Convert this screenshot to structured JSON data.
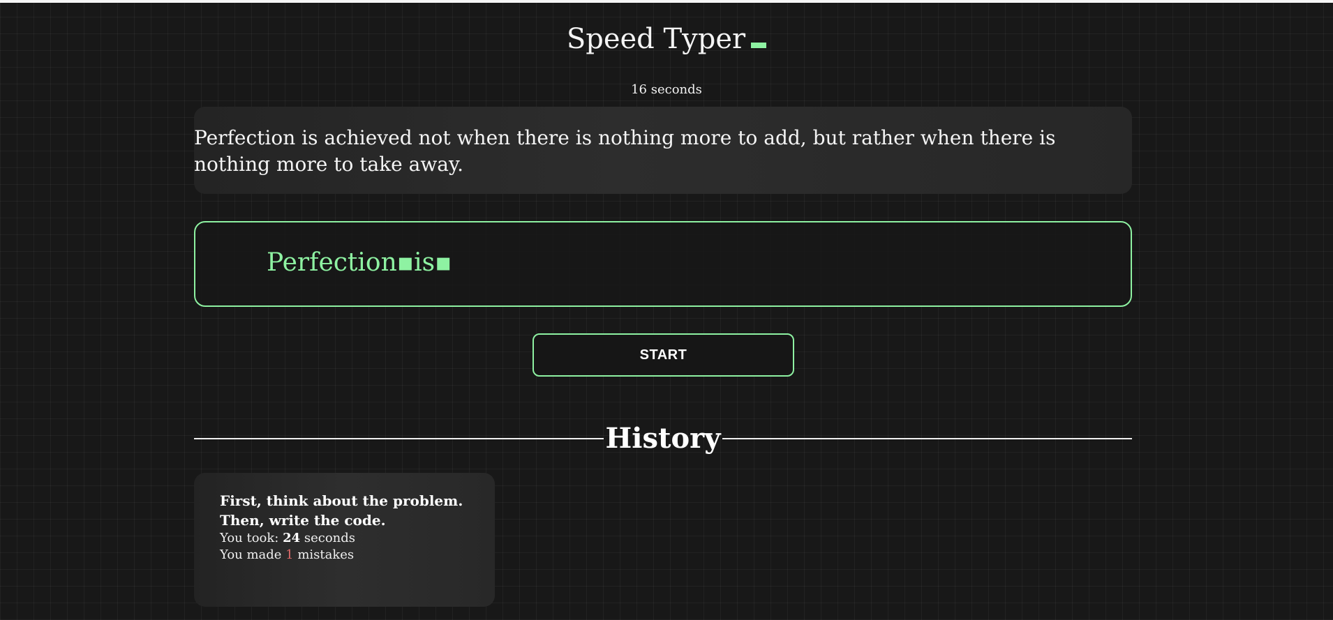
{
  "app": {
    "title": "Speed Typer"
  },
  "timer": {
    "text": "16 seconds"
  },
  "quote": {
    "text": "Perfection is achieved not when there is nothing more to add, but rather when there is nothing more to take away."
  },
  "typing": {
    "typed_text": "Perfection▪is▪"
  },
  "controls": {
    "start_label": "START"
  },
  "history": {
    "title": "History",
    "entries": [
      {
        "quote": "First, think about the problem.\nThen, write the code.",
        "time_prefix": "You took: ",
        "time_value": "24",
        "time_suffix": " seconds",
        "mistakes_prefix": "You made ",
        "mistakes_value": "1",
        "mistakes_suffix": " mistakes"
      }
    ]
  },
  "colors": {
    "accent": "#8ef2a2",
    "background": "#181818",
    "mistake": "#e06a6a"
  }
}
